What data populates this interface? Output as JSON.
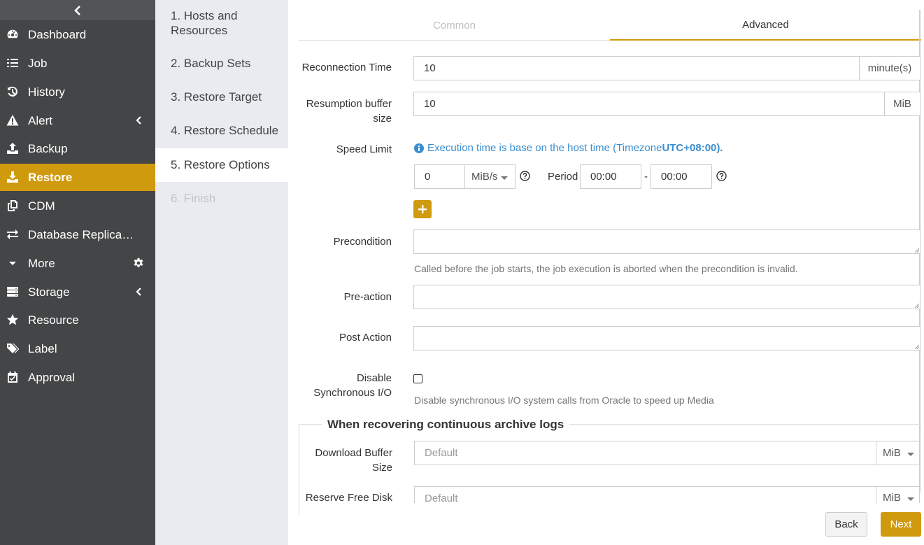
{
  "sidebar": {
    "items": [
      {
        "label": "Dashboard",
        "icon": "tachometer-icon"
      },
      {
        "label": "Job",
        "icon": "list-icon"
      },
      {
        "label": "History",
        "icon": "history-icon"
      },
      {
        "label": "Alert",
        "icon": "warning-icon"
      },
      {
        "label": "Backup",
        "icon": "upload-icon"
      },
      {
        "label": "Restore",
        "icon": "download-icon"
      },
      {
        "label": "CDM",
        "icon": "copy-icon"
      },
      {
        "label": "Database Replica…",
        "icon": "exchange-icon"
      },
      {
        "label": "More",
        "icon": "caret-down-icon"
      },
      {
        "label": "Storage",
        "icon": "database-icon"
      },
      {
        "label": "Resource",
        "icon": "star-icon"
      },
      {
        "label": "Label",
        "icon": "tags-icon"
      },
      {
        "label": "Approval",
        "icon": "calendar-check-icon"
      }
    ],
    "active": "Restore",
    "accent_color": "#d09a0e"
  },
  "steps": [
    {
      "label": "1. Hosts and Resources"
    },
    {
      "label": "2. Backup Sets"
    },
    {
      "label": "3. Restore Target"
    },
    {
      "label": "4. Restore Schedule"
    },
    {
      "label": "5. Restore Options"
    },
    {
      "label": "6. Finish"
    }
  ],
  "tabs": {
    "common": "Common",
    "advanced": "Advanced"
  },
  "form": {
    "reconnection_time": {
      "label": "Reconnection Time",
      "value": "10",
      "unit": "minute(s)"
    },
    "resumption_buffer": {
      "label": "Resumption buffer size",
      "value": "10",
      "unit": "MiB"
    },
    "speed_limit": {
      "label": "Speed Limit",
      "info_prefix": "Execution time is base on the host time (Timezone ",
      "info_tz": "UTC+08:00).",
      "value": "0",
      "unit": "MiB/s",
      "period_label": "Period",
      "period_start": "00:00",
      "dash": "-",
      "period_end": "00:00"
    },
    "precondition": {
      "label": "Precondition",
      "help": "Called before the job starts, the job execution is aborted when the precondition is invalid."
    },
    "pre_action": {
      "label": "Pre-action"
    },
    "post_action": {
      "label": "Post Action"
    },
    "disable_sync_io": {
      "label": "Disable Synchronous I/O",
      "checked": false,
      "help": "Disable synchronous I/O system calls from Oracle to speed up Media"
    }
  },
  "archive_logs": {
    "title": "When recovering continuous archive logs",
    "download_buffer": {
      "label": "Download Buffer Size",
      "placeholder": "Default",
      "unit": "MiB"
    },
    "reserve_free_disk": {
      "label": "Reserve Free Disk",
      "placeholder": "Default",
      "unit": "MiB"
    }
  },
  "buttons": {
    "back": "Back",
    "next": "Next"
  }
}
